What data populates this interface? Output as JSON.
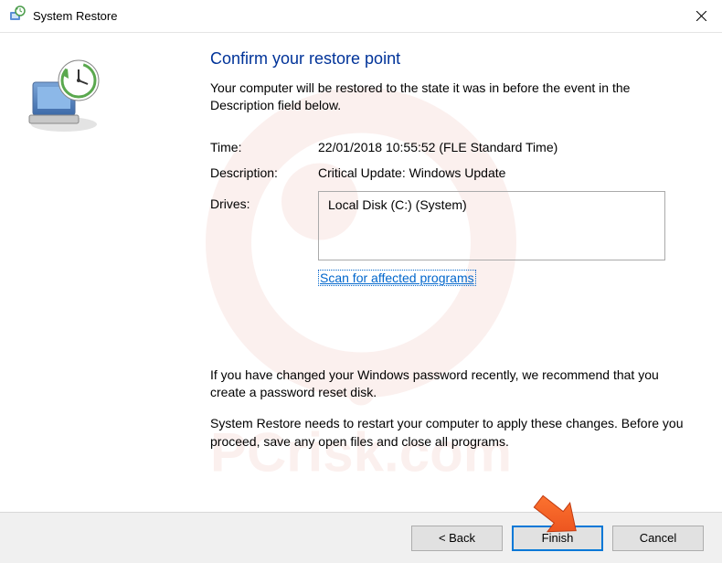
{
  "titlebar": {
    "title": "System Restore"
  },
  "heading": "Confirm your restore point",
  "subtext": "Your computer will be restored to the state it was in before the event in the Description field below.",
  "info": {
    "time_label": "Time:",
    "time_value": "22/01/2018 10:55:52 (FLE Standard Time)",
    "description_label": "Description:",
    "description_value": "Critical Update: Windows Update",
    "drives_label": "Drives:",
    "drives_value": "Local Disk (C:) (System)"
  },
  "scan_link": "Scan for affected programs",
  "warning1": "If you have changed your Windows password recently, we recommend that you create a password reset disk.",
  "warning2": "System Restore needs to restart your computer to apply these changes. Before you proceed, save any open files and close all programs.",
  "buttons": {
    "back": "< Back",
    "finish": "Finish",
    "cancel": "Cancel"
  }
}
